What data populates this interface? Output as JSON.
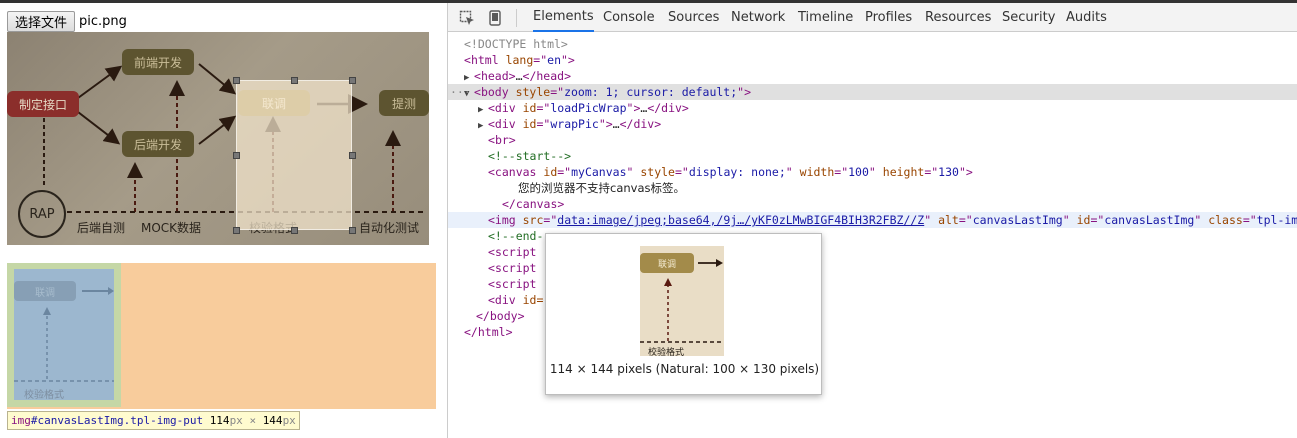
{
  "page": {
    "file_button_label": "选择文件",
    "file_name": "pic.png"
  },
  "diagram": {
    "nodes": {
      "define_api": "制定接口",
      "frontend_dev": "前端开发",
      "backend_dev": "后端开发",
      "integration": "联调",
      "testing": "提测"
    },
    "rap_label": "RAP",
    "bottom_labels": {
      "backend_self_test": "后端自测",
      "mock_data": "MOCK数据",
      "format_check": "校验格式",
      "auto_test": "自动化测试"
    }
  },
  "result": {
    "node_label": "联调",
    "bottom_label": "校验格式"
  },
  "element_tooltip": {
    "tag": "img",
    "selector": "#canvasLastImg.tpl-img-put",
    "width_num": "114",
    "height_num": "144",
    "unit": "px",
    "times": "×"
  },
  "devtools": {
    "tabs": [
      "Elements",
      "Console",
      "Sources",
      "Network",
      "Timeline",
      "Profiles",
      "Resources",
      "Security",
      "Audits"
    ],
    "active_tab": "Elements",
    "icons": [
      "inspect-element-icon",
      "device-mode-icon"
    ],
    "dom": {
      "doctype": "<!DOCTYPE html>",
      "html_tag": "html",
      "html_attr": "lang",
      "html_attr_val": "en",
      "head": "head",
      "head_ellipsis": "…",
      "body_tag": "body",
      "body_attr": "style",
      "body_attr_val": "zoom: 1; cursor: default;",
      "div1_id": "loadPicWrap",
      "div2_id": "wrapPic",
      "br": "br",
      "comment_start": "<!--start-->",
      "canvas_id": "myCanvas",
      "canvas_style": "display: none;",
      "canvas_width": "100",
      "canvas_height": "130",
      "canvas_text": "您的浏览器不支持canvas标签。",
      "img_src": "data:image/jpeg;base64,/9j…/yKF0zLMwBIGF4BIH3R2FBZ//Z",
      "img_alt": "canvasLastImg",
      "img_class": "tpl-img-put",
      "comment_end": "<!--end-->",
      "script": "script",
      "div_id_partial": "id="
    },
    "image_preview": {
      "caption": "114 × 144 pixels (Natural: 100 × 130 pixels)",
      "node_label": "联调",
      "bottom_label": "校验格式"
    }
  },
  "colors": {
    "accent_tab": "#1a73e8",
    "tag": "#881280",
    "attr_name": "#994500",
    "attr_value": "#1a1aa6",
    "comment": "#236e25",
    "result_background": "#f8cc9c",
    "selection_overlay": "#c5d7a6"
  }
}
